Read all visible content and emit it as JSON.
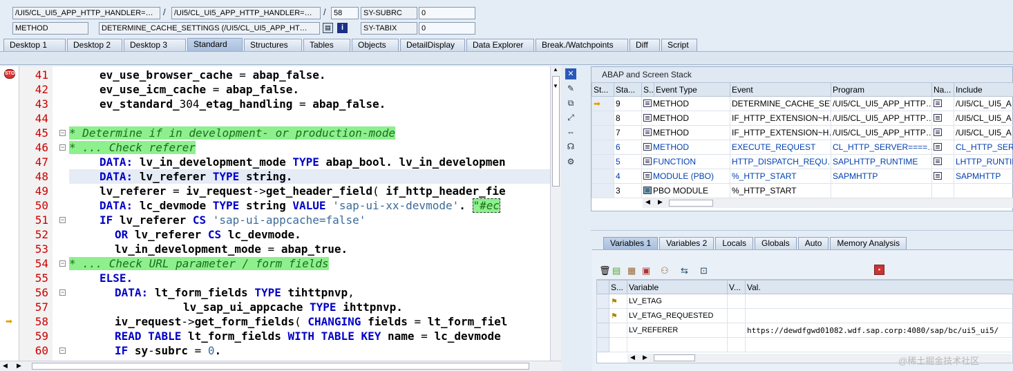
{
  "header": {
    "row1": {
      "class_path": "/UI5/CL_UI5_APP_HTTP_HANDLER=…",
      "include_path": "/UI5/CL_UI5_APP_HTTP_HANDLER=…",
      "line": "58",
      "field_name": "SY-SUBRC",
      "field_value": "0"
    },
    "row2": {
      "type": "METHOD",
      "method": "DETERMINE_CACHE_SETTINGS (/UI5/CL_UI5_APP_HT…",
      "field_name": "SY-TABIX",
      "field_value": "0"
    },
    "slash": "/"
  },
  "tabs": [
    "Desktop 1",
    "Desktop 2",
    "Desktop 3",
    "Standard",
    "Structures",
    "Tables",
    "Objects",
    "DetailDisplay",
    "Data Explorer",
    "Break./Watchpoints",
    "Diff",
    "Script"
  ],
  "active_tab": "Standard",
  "editor": {
    "lines": [
      {
        "n": "41",
        "text": "ev_use_browser_cache = abap_false."
      },
      {
        "n": "42",
        "text": "ev_use_icm_cache = abap_false."
      },
      {
        "n": "43",
        "text": "ev_standard_304_etag_handling = abap_false."
      },
      {
        "n": "44",
        "text": ""
      },
      {
        "n": "45",
        "text": "* Determine if in development- or production-mode"
      },
      {
        "n": "46",
        "text": "* ... Check referer"
      },
      {
        "n": "47",
        "text": "DATA: lv_in_development_mode TYPE abap_bool. lv_in_developmen"
      },
      {
        "n": "48",
        "text": "DATA: lv_referer TYPE string."
      },
      {
        "n": "49",
        "text": "lv_referer = iv_request->get_header_field( if_http_header_fie"
      },
      {
        "n": "50",
        "text": "DATA: lc_devmode TYPE string VALUE 'sap-ui-xx-devmode'. \"#ec"
      },
      {
        "n": "51",
        "text": "IF lv_referer CS 'sap-ui-appcache=false'"
      },
      {
        "n": "52",
        "text": "OR lv_referer CS lc_devmode."
      },
      {
        "n": "53",
        "text": "lv_in_development_mode = abap_true."
      },
      {
        "n": "54",
        "text": "* ... Check URL parameter / form fields"
      },
      {
        "n": "55",
        "text": "ELSE."
      },
      {
        "n": "56",
        "text": "DATA: lt_form_fields TYPE tihttpnvp,"
      },
      {
        "n": "57",
        "text": "lv_sap_ui_appcache TYPE ihttpnvp."
      },
      {
        "n": "58",
        "text": "iv_request->get_form_fields( CHANGING fields = lt_form_fiel"
      },
      {
        "n": "59",
        "text": "READ TABLE lt_form_fields WITH TABLE KEY name = lc_devmode"
      },
      {
        "n": "60",
        "text": "IF sy-subrc = 0."
      }
    ],
    "current_line": "58",
    "breakpoint_line": "41"
  },
  "stack": {
    "title": "ABAP and Screen Stack",
    "columns": [
      "St...",
      "Sta...",
      "S...",
      "Event Type",
      "Event",
      "Program",
      "Na...",
      "Include"
    ],
    "rows": [
      {
        "level": "9",
        "type": "METHOD",
        "event": "DETERMINE_CACHE_SET…",
        "program": "/UI5/CL_UI5_APP_HTTP…",
        "include": "/UI5/CL_UI5_A"
      },
      {
        "level": "8",
        "type": "METHOD",
        "event": "IF_HTTP_EXTENSION~H…",
        "program": "/UI5/CL_UI5_APP_HTTP…",
        "include": "/UI5/CL_UI5_A"
      },
      {
        "level": "7",
        "type": "METHOD",
        "event": "IF_HTTP_EXTENSION~H…",
        "program": "/UI5/CL_UI5_APP_HTTP…",
        "include": "/UI5/CL_UI5_A"
      },
      {
        "level": "6",
        "type": "METHOD",
        "event": "EXECUTE_REQUEST",
        "program": "CL_HTTP_SERVER====…",
        "include": "CL_HTTP_SERV"
      },
      {
        "level": "5",
        "type": "FUNCTION",
        "event": "HTTP_DISPATCH_REQU…",
        "program": "SAPLHTTP_RUNTIME",
        "include": "LHTTP_RUNTIM"
      },
      {
        "level": "4",
        "type": "MODULE (PBO)",
        "event": "%_HTTP_START",
        "program": "SAPMHTTP",
        "include": "SAPMHTTP"
      },
      {
        "level": "3",
        "type": "PBO MODULE",
        "event": "%_HTTP_START",
        "program": "",
        "include": ""
      }
    ]
  },
  "var_tabs": [
    "Variables 1",
    "Variables 2",
    "Locals",
    "Globals",
    "Auto",
    "Memory Analysis"
  ],
  "variables": {
    "columns": [
      "S...",
      "Variable",
      "V...",
      "Val."
    ],
    "rows": [
      {
        "name": "LV_ETAG",
        "value": ""
      },
      {
        "name": "LV_ETAG_REQUESTED",
        "value": ""
      },
      {
        "name": "LV_REFERER",
        "value": "https://dewdfgwd01082.wdf.sap.corp:4080/sap/bc/ui5_ui5/"
      }
    ]
  },
  "watermark": "@稀土掘金技术社区"
}
